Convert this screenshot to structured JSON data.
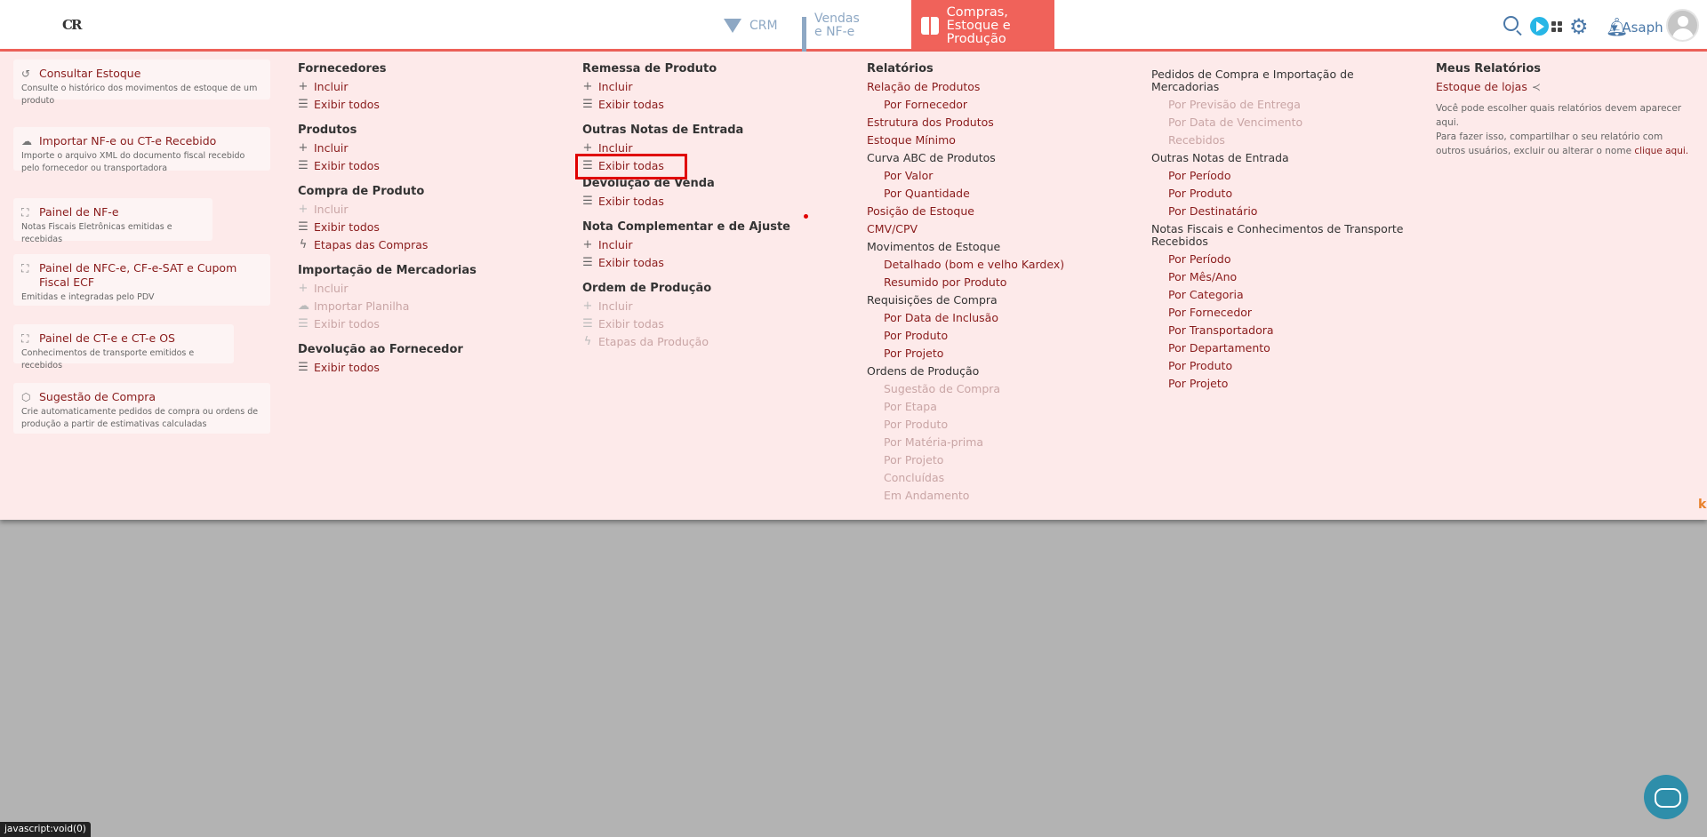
{
  "logo": "CR",
  "nav": {
    "crm": "CRM",
    "vendas": "Vendas e NF-e",
    "compras": "Compras, Estoque e Produção"
  },
  "user": {
    "name": "Asaph"
  },
  "cards": [
    {
      "title": "Consultar Estoque",
      "desc": "Consulte o histórico dos movimentos de estoque de um produto",
      "icon": "history-icon"
    },
    {
      "title": "Importar NF-e ou CT-e Recebido",
      "desc": "Importe o arquivo XML do documento fiscal recebido pelo fornecedor ou transportadora",
      "icon": "cloud-upload-icon"
    },
    {
      "title": "Painel de NF-e",
      "desc": "Notas Fiscais Eletrônicas emitidas e recebidas",
      "icon": "expand-icon"
    },
    {
      "title": "Painel de NFC-e, CF-e-SAT e Cupom Fiscal ECF",
      "desc": "Emitidas e integradas pelo PDV",
      "icon": "expand-icon"
    },
    {
      "title": "Painel de CT-e e CT-e OS",
      "desc": "Conhecimentos de transporte emitidos e recebidos",
      "icon": "expand-icon"
    },
    {
      "title": "Sugestão de Compra",
      "desc": "Crie automaticamente pedidos de compra ou ordens de produção a partir de estimativas calculadas",
      "icon": "cube-icon"
    }
  ],
  "col2": {
    "fornecedores": {
      "title": "Fornecedores",
      "incluir": "Incluir",
      "exibir": "Exibir todos"
    },
    "produtos": {
      "title": "Produtos",
      "incluir": "Incluir",
      "exibir": "Exibir todos"
    },
    "compra": {
      "title": "Compra de Produto",
      "incluir": "Incluir",
      "exibir": "Exibir todos",
      "etapas": "Etapas das Compras"
    },
    "importacao": {
      "title": "Importação de Mercadorias",
      "incluir": "Incluir",
      "planilha": "Importar Planilha",
      "exibir": "Exibir todos"
    },
    "devolucao": {
      "title": "Devolução ao Fornecedor",
      "exibir": "Exibir todos"
    }
  },
  "col3": {
    "remessa": {
      "title": "Remessa de Produto",
      "incluir": "Incluir",
      "exibir": "Exibir todas"
    },
    "outras": {
      "title": "Outras Notas de Entrada",
      "incluir": "Incluir",
      "exibir": "Exibir todas"
    },
    "devvenda": {
      "title": "Devolução de Venda",
      "exibir": "Exibir todas"
    },
    "complementar": {
      "title": "Nota Complementar e de Ajuste",
      "incluir": "Incluir",
      "exibir": "Exibir todas"
    },
    "ordem": {
      "title": "Ordem de Produção",
      "incluir": "Incluir",
      "exibir": "Exibir todas",
      "etapas": "Etapas da Produção"
    }
  },
  "relatorios": {
    "title": "Relatórios",
    "items": [
      {
        "label": "Relação de Produtos",
        "level": 1
      },
      {
        "label": "Por Fornecedor",
        "level": 2
      },
      {
        "label": "Estrutura dos Produtos",
        "level": 1
      },
      {
        "label": "Estoque Mínimo",
        "level": 1
      },
      {
        "label": "Curva ABC de Produtos",
        "level": 0
      },
      {
        "label": "Por Valor",
        "level": 2
      },
      {
        "label": "Por Quantidade",
        "level": 2
      },
      {
        "label": "Posição de Estoque",
        "level": 1
      },
      {
        "label": "CMV/CPV",
        "level": 1
      },
      {
        "label": "Movimentos de Estoque",
        "level": 0
      },
      {
        "label": "Detalhado (bom e velho Kardex)",
        "level": 2
      },
      {
        "label": "Resumido por Produto",
        "level": 2
      },
      {
        "label": "Requisições de Compra",
        "level": 0
      },
      {
        "label": "Por Data de Inclusão",
        "level": 2
      },
      {
        "label": "Por Produto",
        "level": 2
      },
      {
        "label": "Por Projeto",
        "level": 2
      },
      {
        "label": "Ordens de Produção",
        "level": 0
      },
      {
        "label": "Sugestão de Compra",
        "level": 3
      },
      {
        "label": "Por Etapa",
        "level": 3
      },
      {
        "label": "Por Produto",
        "level": 3
      },
      {
        "label": "Por Matéria-prima",
        "level": 3
      },
      {
        "label": "Por Projeto",
        "level": 3
      },
      {
        "label": "Concluídas",
        "level": 3
      },
      {
        "label": "Em Andamento",
        "level": 3
      }
    ]
  },
  "col5": {
    "items": [
      {
        "label": "Pedidos de Compra e Importação de Mercadorias",
        "level": 0,
        "two": true
      },
      {
        "label": "Por Previsão de Entrega",
        "level": 3
      },
      {
        "label": "Por Data de Vencimento",
        "level": 3
      },
      {
        "label": "Recebidos",
        "level": 3
      },
      {
        "label": "Outras Notas de Entrada",
        "level": 0
      },
      {
        "label": "Por Período",
        "level": 2
      },
      {
        "label": "Por Produto",
        "level": 2
      },
      {
        "label": "Por Destinatário",
        "level": 2
      },
      {
        "label": "Notas Fiscais e Conhecimentos de Transporte Recebidos",
        "level": 0,
        "two": true
      },
      {
        "label": "Por Período",
        "level": 2
      },
      {
        "label": "Por Mês/Ano",
        "level": 2
      },
      {
        "label": "Por Categoria",
        "level": 2
      },
      {
        "label": "Por Fornecedor",
        "level": 2
      },
      {
        "label": "Por Transportadora",
        "level": 2
      },
      {
        "label": "Por Departamento",
        "level": 2
      },
      {
        "label": "Por Produto",
        "level": 2
      },
      {
        "label": "Por Projeto",
        "level": 2
      }
    ]
  },
  "meus": {
    "title": "Meus Relatórios",
    "link": "Estoque de lojas",
    "desc1": "Você pode escolher quais relatórios devem aparecer aqui.",
    "desc2": "Para fazer isso, compartilhar o seu relatório com outros usuários, excluir ou alterar o nome",
    "cta": "clique aqui."
  },
  "status": "javascript:void(0)",
  "colors": {
    "accent": "#f0625a",
    "link": "#8a1c1c",
    "menu_bg": "#fdeaea"
  }
}
